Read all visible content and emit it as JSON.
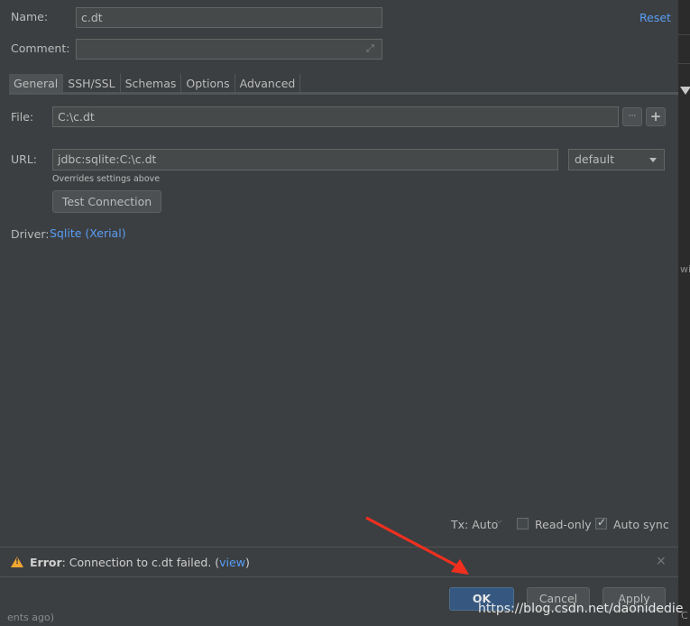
{
  "form": {
    "name_label": "Name:",
    "name_value": "c.dt",
    "comment_label": "Comment:",
    "comment_value": "",
    "reset_label": "Reset"
  },
  "tabs": [
    "General",
    "SSH/SSL",
    "Schemas",
    "Options",
    "Advanced"
  ],
  "general": {
    "file_label": "File:",
    "file_value": "C:\\c.dt",
    "browse_label": "···",
    "add_label": "+",
    "url_label": "URL:",
    "url_value": "jdbc:sqlite:C:\\c.dt",
    "url_mode": "default",
    "overrides_note": "Overrides settings above",
    "test_connection_label": "Test Connection",
    "driver_label": "Driver:",
    "driver_value": "Sqlite (Xerial)"
  },
  "options": {
    "tx_label": "Tx: Auto",
    "readonly_label": "Read-only",
    "readonly_checked": false,
    "autosync_label": "Auto sync",
    "autosync_checked": true
  },
  "error": {
    "prefix": "Error",
    "message": ": Connection to c.dt failed. (",
    "view_link": "view",
    "suffix": ")",
    "close": "×"
  },
  "buttons": {
    "ok": "OK",
    "cancel": "Cancel",
    "apply": "Apply"
  },
  "background": {
    "bottom_left_text": "ents ago)",
    "right_edge_text_1": "wi",
    "right_edge_text_2": "C"
  },
  "watermark": "https://blog.csdn.net/daonidedie",
  "colors": {
    "dialog_bg": "#3c3f41",
    "link": "#589df6",
    "primary_button": "#365880",
    "warning": "#f0a732",
    "annotation_arrow": "#f22f1f"
  }
}
